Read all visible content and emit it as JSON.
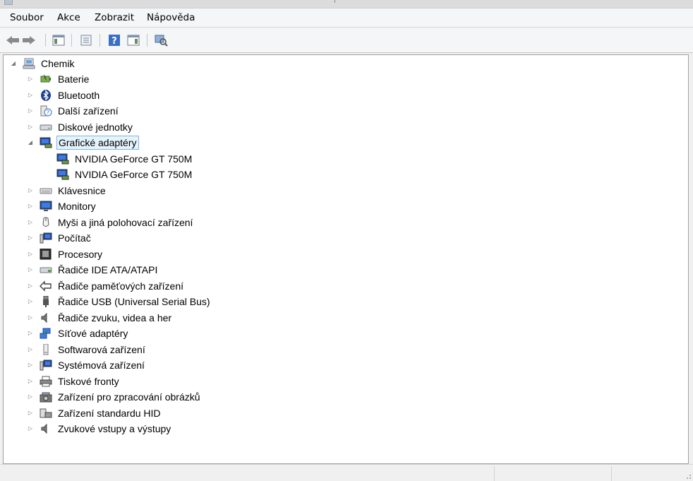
{
  "menubar": {
    "items": [
      "Soubor",
      "Akce",
      "Zobrazit",
      "Nápověda"
    ]
  },
  "toolbar": {
    "buttons": [
      "back-arrow-icon",
      "forward-arrow-icon",
      "show-hide-console-tree-icon",
      "properties-icon",
      "help-icon",
      "action-pane-icon",
      "scan-hardware-changes-icon"
    ]
  },
  "tree": {
    "root": {
      "label": "Chemik",
      "icon": "computer-icon",
      "expanded": true
    },
    "categories": [
      {
        "label": "Baterie",
        "icon": "battery-icon"
      },
      {
        "label": "Bluetooth",
        "icon": "bluetooth-icon"
      },
      {
        "label": "Další zařízení",
        "icon": "unknown-device-icon"
      },
      {
        "label": "Diskové jednotky",
        "icon": "disk-drive-icon"
      },
      {
        "label": "Grafické adaptéry",
        "icon": "display-adapter-icon",
        "expanded": true,
        "selected": true,
        "children": [
          "NVIDIA GeForce GT 750M",
          "NVIDIA GeForce GT 750M"
        ]
      },
      {
        "label": "Klávesnice",
        "icon": "keyboard-icon"
      },
      {
        "label": "Monitory",
        "icon": "monitor-icon"
      },
      {
        "label": "Myši a jiná polohovací zařízení",
        "icon": "mouse-icon"
      },
      {
        "label": "Počítač",
        "icon": "computer-icon"
      },
      {
        "label": "Procesory",
        "icon": "processor-icon"
      },
      {
        "label": "Řadiče IDE ATA/ATAPI",
        "icon": "ide-controller-icon"
      },
      {
        "label": "Řadiče paměťových zařízení",
        "icon": "storage-controller-icon"
      },
      {
        "label": "Řadiče USB (Universal Serial Bus)",
        "icon": "usb-icon"
      },
      {
        "label": "Řadiče zvuku, videa a her",
        "icon": "speaker-icon"
      },
      {
        "label": "Síťové adaptéry",
        "icon": "network-adapter-icon"
      },
      {
        "label": "Softwarová zařízení",
        "icon": "software-device-icon"
      },
      {
        "label": "Systémová zařízení",
        "icon": "system-device-icon"
      },
      {
        "label": "Tiskové fronty",
        "icon": "printer-icon"
      },
      {
        "label": "Zařízení pro zpracování obrázků",
        "icon": "camera-icon"
      },
      {
        "label": "Zařízení standardu HID",
        "icon": "hid-icon"
      },
      {
        "label": "Zvukové vstupy a výstupy",
        "icon": "audio-io-icon"
      }
    ]
  },
  "colors": {
    "selection_bg": "#e5f3fb",
    "selection_border": "#7eb4ea",
    "tree_bg": "#ffffff",
    "chrome_bg": "#f0f0f0"
  }
}
